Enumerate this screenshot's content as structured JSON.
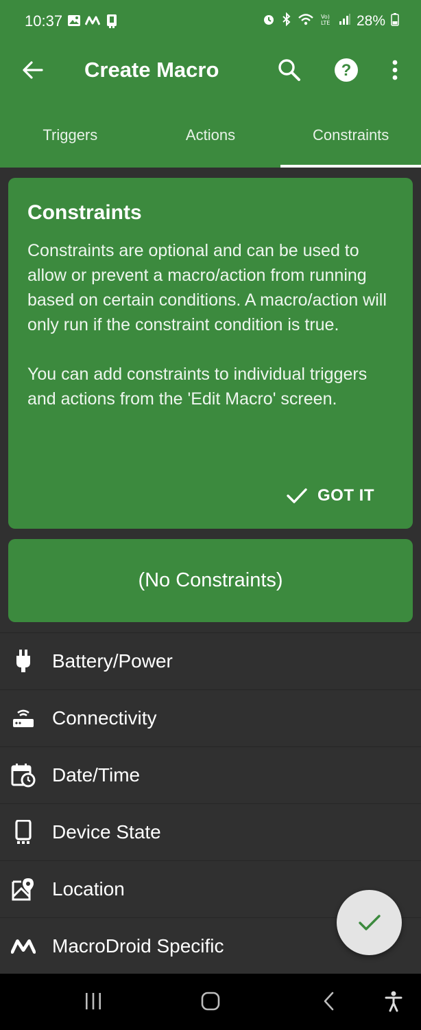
{
  "status_bar": {
    "time": "10:37",
    "battery": "28%",
    "left_icons": [
      "gallery-icon",
      "macrodroid-icon",
      "device-icon"
    ],
    "right_icons": [
      "alarm-icon",
      "bluetooth-icon",
      "wifi-icon",
      "volte-icon",
      "signal-icon",
      "battery-icon"
    ]
  },
  "toolbar": {
    "title": "Create Macro",
    "back_icon": "arrow-left-icon",
    "search_icon": "search-icon",
    "help_icon": "help-icon",
    "more_icon": "more-vert-icon"
  },
  "tabs": [
    {
      "label": "Triggers",
      "active": false
    },
    {
      "label": "Actions",
      "active": false
    },
    {
      "label": "Constraints",
      "active": true
    }
  ],
  "info_card": {
    "title": "Constraints",
    "paragraph1": "Constraints are optional and can be used to allow or prevent a macro/action from running based on certain conditions. A macro/action will only run if the constraint condition is true.",
    "paragraph2": "You can add constraints to individual triggers and actions from the 'Edit Macro' screen.",
    "button_label": "GOT IT"
  },
  "no_constraints_label": "(No Constraints)",
  "categories": [
    {
      "label": "Battery/Power",
      "icon": "plug-icon"
    },
    {
      "label": "Connectivity",
      "icon": "router-icon"
    },
    {
      "label": "Date/Time",
      "icon": "calendar-clock-icon"
    },
    {
      "label": "Device State",
      "icon": "phone-icon"
    },
    {
      "label": "Location",
      "icon": "map-pin-icon"
    },
    {
      "label": "MacroDroid Specific",
      "icon": "macrodroid-icon"
    }
  ],
  "colors": {
    "primary": "#3c8a3e",
    "background": "#303030",
    "fab": "#e4e4e4",
    "fab_check": "#3c8a3e"
  },
  "nav_bar": [
    "recents-icon",
    "home-icon",
    "back-icon",
    "accessibility-icon"
  ]
}
